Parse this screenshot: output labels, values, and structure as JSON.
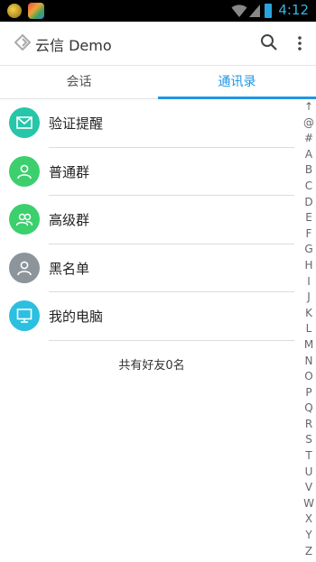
{
  "status_bar": {
    "time": "4:12",
    "icons": [
      "notification-app-icon",
      "notification-app-icon",
      "wifi-icon",
      "signal-icon",
      "battery-icon"
    ]
  },
  "app_bar": {
    "title": "云信 Demo",
    "icons": [
      "yunxin-logo-icon",
      "search-icon",
      "more-vert-icon"
    ]
  },
  "tabs": [
    {
      "label": "会话",
      "selected": false
    },
    {
      "label": "通讯录",
      "selected": true
    }
  ],
  "accent_color": "#2196e3",
  "contacts": [
    {
      "label": "验证提醒",
      "icon": "envelope-icon",
      "color": "#26c6a8"
    },
    {
      "label": "普通群",
      "icon": "person-icon",
      "color": "#3ccf6e"
    },
    {
      "label": "高级群",
      "icon": "group-icon",
      "color": "#3ccf6e"
    },
    {
      "label": "黑名单",
      "icon": "person-icon",
      "color": "#8c949c"
    },
    {
      "label": "我的电脑",
      "icon": "monitor-icon",
      "color": "#2cc0e0"
    }
  ],
  "footer_text": "共有好友0名",
  "index_letters": [
    "↑",
    "@",
    "#",
    "A",
    "B",
    "C",
    "D",
    "E",
    "F",
    "G",
    "H",
    "I",
    "J",
    "K",
    "L",
    "M",
    "N",
    "O",
    "P",
    "Q",
    "R",
    "S",
    "T",
    "U",
    "V",
    "W",
    "X",
    "Y",
    "Z"
  ]
}
